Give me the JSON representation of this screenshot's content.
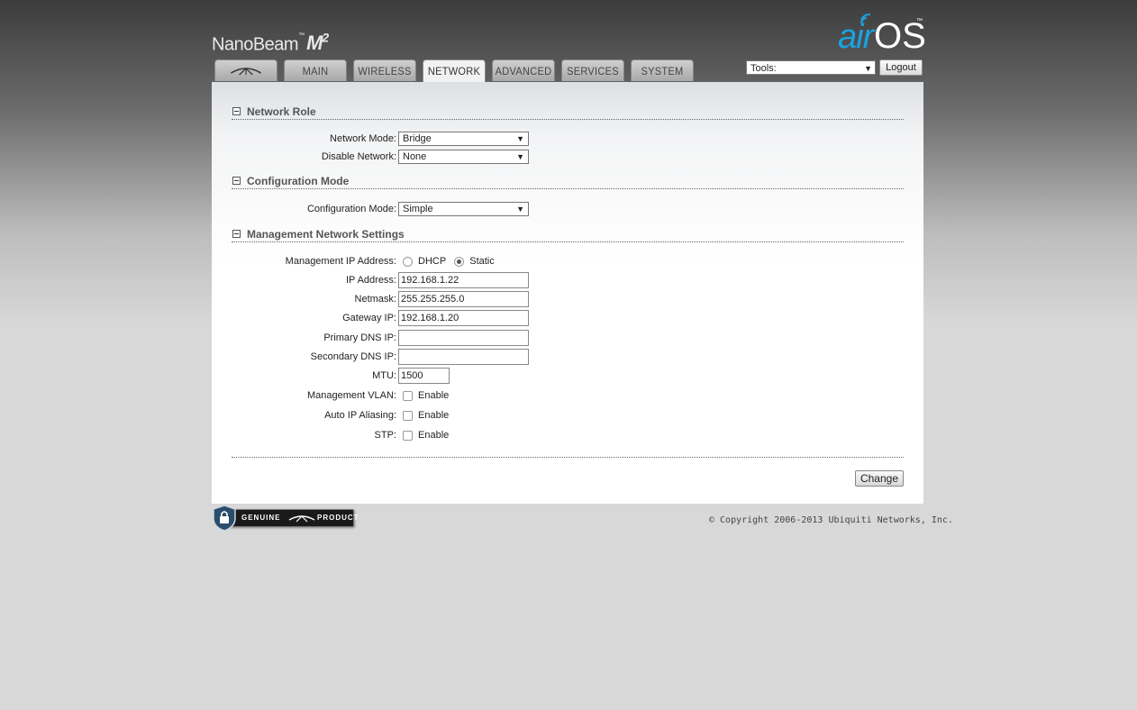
{
  "brand": {
    "name": "NanoBeam",
    "tm": "™",
    "model": "M",
    "model_sup": "2"
  },
  "airos": {
    "air": "air",
    "os": "OS",
    "tm": "™"
  },
  "tabs": [
    {
      "label": "",
      "icon": "ubiquiti-logo-icon"
    },
    {
      "label": "MAIN"
    },
    {
      "label": "WIRELESS"
    },
    {
      "label": "NETWORK",
      "active": true
    },
    {
      "label": "ADVANCED"
    },
    {
      "label": "SERVICES"
    },
    {
      "label": "SYSTEM"
    }
  ],
  "tools": {
    "label": "Tools:",
    "logout": "Logout"
  },
  "sections": {
    "network_role": {
      "title": "Network Role",
      "network_mode": {
        "label": "Network Mode:",
        "value": "Bridge"
      },
      "disable_network": {
        "label": "Disable Network:",
        "value": "None"
      }
    },
    "configuration_mode": {
      "title": "Configuration Mode",
      "configuration_mode": {
        "label": "Configuration Mode:",
        "value": "Simple"
      }
    },
    "management": {
      "title": "Management Network Settings",
      "mgmt_ip": {
        "label": "Management IP Address:",
        "option_dhcp": "DHCP",
        "option_static": "Static",
        "selected": "Static"
      },
      "ip_address": {
        "label": "IP Address:",
        "value": "192.168.1.22"
      },
      "netmask": {
        "label": "Netmask:",
        "value": "255.255.255.0"
      },
      "gateway": {
        "label": "Gateway IP:",
        "value": "192.168.1.20"
      },
      "primary_dns": {
        "label": "Primary DNS IP:",
        "value": ""
      },
      "secondary_dns": {
        "label": "Secondary DNS IP:",
        "value": ""
      },
      "mtu": {
        "label": "MTU:",
        "value": "1500"
      },
      "mgmt_vlan": {
        "label": "Management VLAN:",
        "option": "Enable",
        "checked": false
      },
      "auto_ip_aliasing": {
        "label": "Auto IP Aliasing:",
        "option": "Enable",
        "checked": false
      },
      "stp": {
        "label": "STP:",
        "option": "Enable",
        "checked": false
      }
    }
  },
  "buttons": {
    "change": "Change"
  },
  "footer": {
    "genuine_left": "GENUINE",
    "genuine_right": "PRODUCT",
    "copyright": "© Copyright 2006-2013 Ubiquiti Networks, Inc."
  },
  "colors": {
    "accent": "#1aa3e0",
    "panel": "#ffffff",
    "background": "#d9d9d9"
  }
}
